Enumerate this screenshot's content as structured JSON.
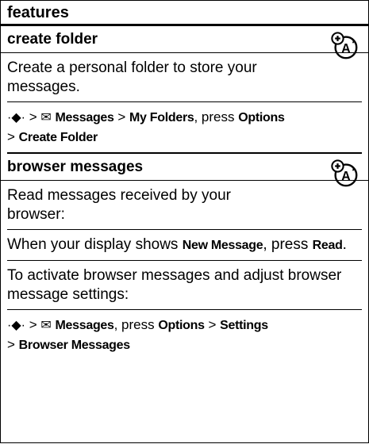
{
  "header": {
    "title": "features"
  },
  "sections": [
    {
      "title": "create folder",
      "icon": "network-feature-icon",
      "desc": "Create a personal folder to store your messages.",
      "path": {
        "nav_glyph": "·◆·",
        "sep": ">",
        "messages_glyph": "✉",
        "messages": "Messages",
        "my_folders": "My Folders",
        "comma_press": ", press",
        "options": "Options",
        "create_folder": "Create Folder"
      }
    },
    {
      "title": "browser messages",
      "icon": "network-feature-icon",
      "desc": "Read messages received by your browser:",
      "instruction": {
        "prefix": "When your display shows",
        "new_message": "New Message",
        "press": ", press",
        "read": "Read",
        "period": "."
      },
      "activate": "To activate browser messages and adjust browser message settings:",
      "path": {
        "nav_glyph": "·◆·",
        "sep": ">",
        "messages_glyph": "✉",
        "messages": "Messages",
        "comma_press": ", press",
        "options": "Options",
        "settings": "Settings",
        "browser_messages": "Browser Messages"
      }
    }
  ]
}
